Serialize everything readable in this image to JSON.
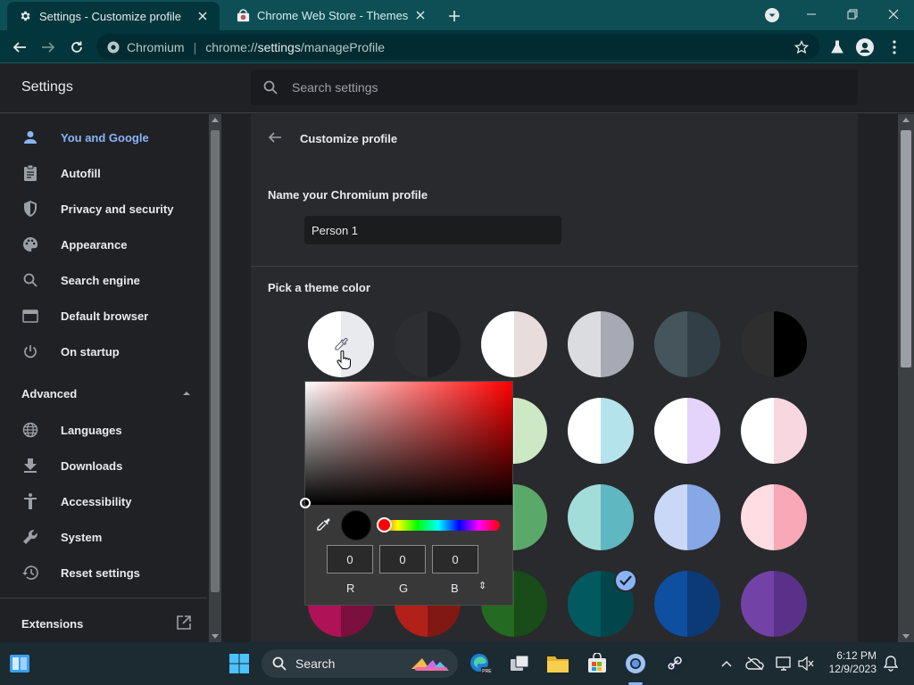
{
  "tabs": [
    {
      "title": "Settings - Customize profile",
      "icon": "gear-icon",
      "active": true
    },
    {
      "title": "Chrome Web Store - Themes",
      "icon": "web-store-icon",
      "active": false
    }
  ],
  "toolbar": {
    "site_label": "Chromium",
    "url_prefix": "chrome://",
    "url_host": "settings",
    "url_path": "/manageProfile"
  },
  "settings": {
    "title": "Settings",
    "search_placeholder": "Search settings"
  },
  "sidebar": {
    "items": [
      {
        "label": "You and Google",
        "icon": "person-icon",
        "active": true
      },
      {
        "label": "Autofill",
        "icon": "clipboard-icon"
      },
      {
        "label": "Privacy and security",
        "icon": "shield-icon"
      },
      {
        "label": "Appearance",
        "icon": "palette-icon"
      },
      {
        "label": "Search engine",
        "icon": "search-icon"
      },
      {
        "label": "Default browser",
        "icon": "browser-icon"
      },
      {
        "label": "On startup",
        "icon": "power-icon"
      }
    ],
    "advanced_label": "Advanced",
    "advanced_items": [
      {
        "label": "Languages",
        "icon": "globe-icon"
      },
      {
        "label": "Downloads",
        "icon": "download-icon"
      },
      {
        "label": "Accessibility",
        "icon": "accessibility-icon"
      },
      {
        "label": "System",
        "icon": "wrench-icon"
      },
      {
        "label": "Reset settings",
        "icon": "history-icon"
      }
    ],
    "extensions_label": "Extensions"
  },
  "main": {
    "page_title": "Customize profile",
    "name_label": "Name your Chromium profile",
    "name_value": "Person 1",
    "theme_label": "Pick a theme color",
    "swatches": [
      {
        "left": "#ffffff",
        "right": "#e8eaed",
        "kind": "custom"
      },
      {
        "left": "#2c2e32",
        "right": "#1f2124"
      },
      {
        "left": "#ffffff",
        "right": "#e9dcdc"
      },
      {
        "left": "#dadce0",
        "right": "#a7aab4"
      },
      {
        "left": "#46545c",
        "right": "#323f46"
      },
      {
        "left": "#2e2e2e",
        "right": "#000000"
      },
      {
        "left": "#2c2e32",
        "right": "#1f2124"
      },
      {
        "left": "#2c2e32",
        "right": "#1f2124"
      },
      {
        "left": "#ffffff",
        "right": "#cde8c4"
      },
      {
        "left": "#ffffff",
        "right": "#b5e3ec"
      },
      {
        "left": "#ffffff",
        "right": "#e4d4fb"
      },
      {
        "left": "#ffffff",
        "right": "#f8d7e1"
      },
      {
        "left": "#2c2e32",
        "right": "#1f2124"
      },
      {
        "left": "#2c2e32",
        "right": "#1f2124"
      },
      {
        "left": "#7ac087",
        "right": "#5aa86a"
      },
      {
        "left": "#a3ddd9",
        "right": "#5fb8c1"
      },
      {
        "left": "#c8d8f6",
        "right": "#86a8e6"
      },
      {
        "left": "#ffdde3",
        "right": "#f8a8b6"
      },
      {
        "left": "#b01257",
        "right": "#7b0f3e"
      },
      {
        "left": "#b2201a",
        "right": "#821814"
      },
      {
        "left": "#246a22",
        "right": "#194c18"
      },
      {
        "left": "#02595f",
        "right": "#02464b",
        "selected": true
      },
      {
        "left": "#0e4fa1",
        "right": "#0b3a77"
      },
      {
        "left": "#7342a6",
        "right": "#5a3188"
      }
    ]
  },
  "picker": {
    "r": "0",
    "g": "0",
    "b": "0",
    "r_label": "R",
    "g_label": "G",
    "b_label": "B",
    "mode_icon": "⇕"
  },
  "taskbar": {
    "search_label": "Search",
    "time": "6:12 PM",
    "date": "12/9/2023"
  }
}
